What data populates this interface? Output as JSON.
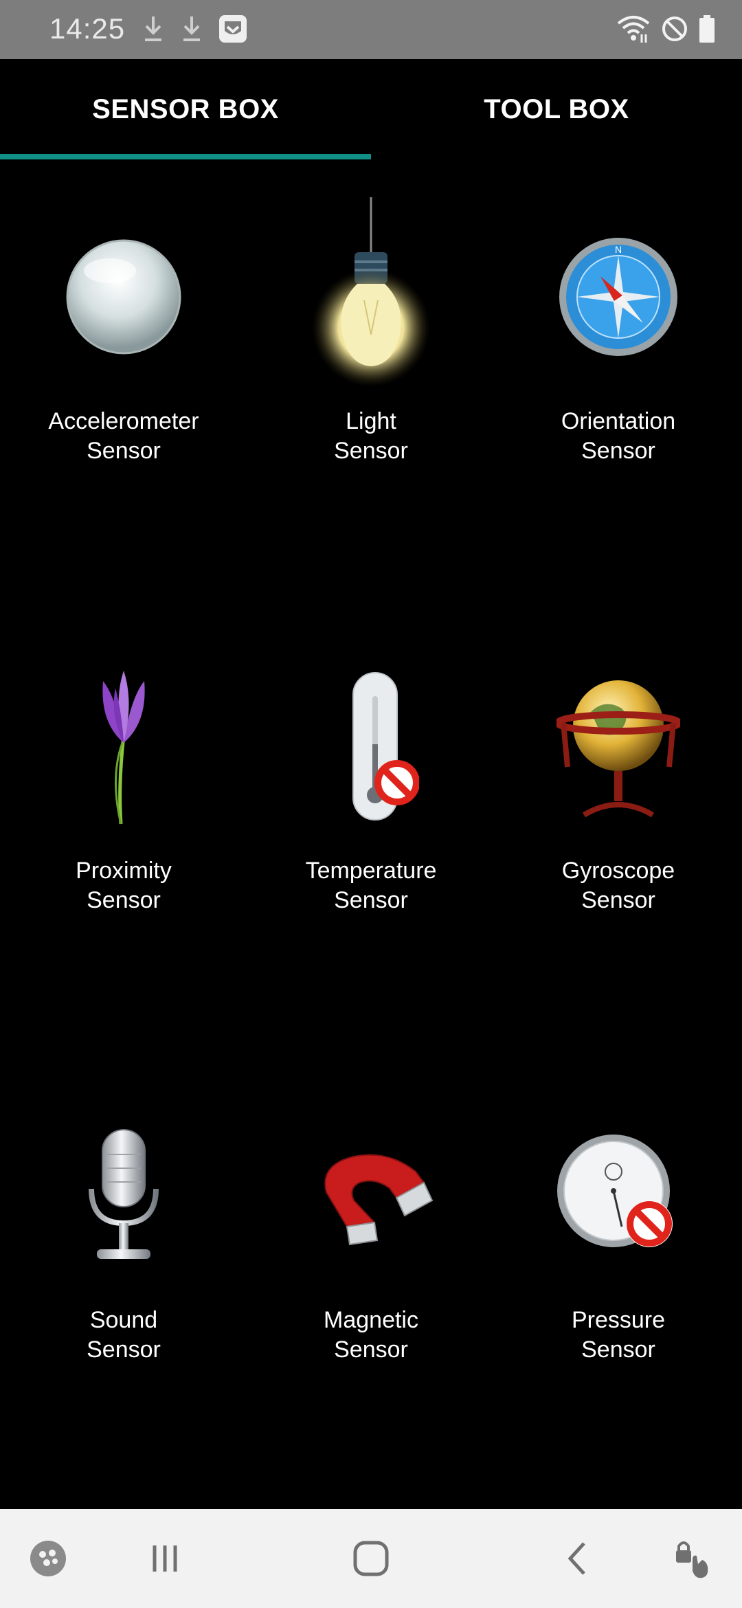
{
  "status_bar": {
    "time": "14:25",
    "left_icons": [
      "download-icon",
      "download-icon",
      "app-shield-icon"
    ],
    "right_icons": [
      "wifi-icon",
      "do-not-disturb-icon",
      "battery-icon"
    ]
  },
  "tabs": [
    {
      "label": "SENSOR BOX",
      "selected": true
    },
    {
      "label": "TOOL BOX",
      "selected": false
    }
  ],
  "accent_color": "#108f87",
  "sensors": [
    {
      "line1": "Accelerometer",
      "line2": "Sensor",
      "icon": "glass-sphere-icon"
    },
    {
      "line1": "Light",
      "line2": "Sensor",
      "icon": "light-bulb-icon"
    },
    {
      "line1": "Orientation",
      "line2": "Sensor",
      "icon": "compass-icon"
    },
    {
      "line1": "Proximity",
      "line2": "Sensor",
      "icon": "crocus-flower-icon"
    },
    {
      "line1": "Temperature",
      "line2": "Sensor",
      "icon": "thermometer-unavailable-icon"
    },
    {
      "line1": "Gyroscope",
      "line2": "Sensor",
      "icon": "globe-gyroscope-icon"
    },
    {
      "line1": "Sound",
      "line2": "Sensor",
      "icon": "microphone-icon"
    },
    {
      "line1": "Magnetic",
      "line2": "Sensor",
      "icon": "horseshoe-magnet-icon"
    },
    {
      "line1": "Pressure",
      "line2": "Sensor",
      "icon": "barometer-unavailable-icon"
    }
  ],
  "nav_bar": {
    "items": [
      "game-launcher-icon",
      "recent-apps-icon",
      "home-icon",
      "back-icon",
      "touch-lock-icon"
    ]
  }
}
